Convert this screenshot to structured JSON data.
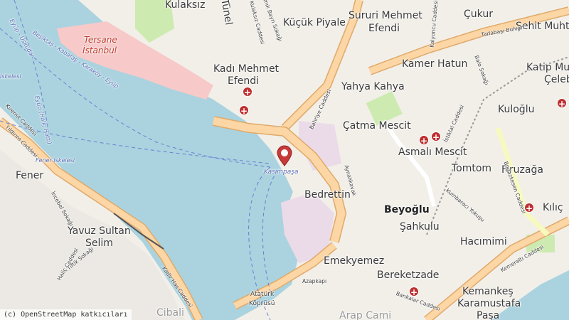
{
  "map": {
    "colors": {
      "water": "#aad3df",
      "land": "#f2efe9",
      "road_major": "#fcd6a4",
      "road_outline": "#e0a96a",
      "industrial": "#ebdbe8",
      "military": "#f7c9c9",
      "park": "#cdebb0"
    },
    "marker": {
      "icon": "map-pin-icon",
      "place": "Kasımpaşa",
      "color": "#c83a3a"
    },
    "districts": {
      "kulaksiz": "Kulaksız",
      "tunel": "Tünel",
      "kucuk_piyale": "Küçük Piyale",
      "sururi": "Sururi Mehmet",
      "efendi1": "Efendi",
      "cukur": "Çukur",
      "sehit": "Şehit Muhtar",
      "tersane": "Tersane",
      "istanbul": "İstanbul",
      "kadi": "Kadı Mehmet",
      "efendi2": "Efendi",
      "kamer": "Kamer Hatun",
      "katip": "Katip Musta",
      "celebi": "Çelebi",
      "yahya": "Yahya Kahya",
      "kuloglu": "Kuloğlu",
      "catma": "Çatma Mescit",
      "asmali": "Asmalı Mescit",
      "tomtom": "Tomtom",
      "firuzaga": "Firuzağa",
      "fener": "Fener",
      "bedrettin": "Bedrettin",
      "beyoglu": "Beyoğlu",
      "kilic": "Kılıç",
      "sahkulu": "Şahkulu",
      "yavuz": "Yavuz Sultan",
      "selim": "Selim",
      "hacimimi": "Hacımimi",
      "emekyemez": "Emekyemez",
      "bereketzade": "Bereketzade",
      "kemankes": "Kemankeş",
      "karamustafa": "Karamustafa",
      "pasa": "Paşa",
      "cibali": "Cibali",
      "arap": "Arap Cami"
    },
    "streets": {
      "kulaksiz_cad": "Kulaksız Caddesi",
      "namik": "Namık Bayrı Sokağı",
      "bahriye": "Bahriye Caddesi",
      "tarlabasi": "Tarlabaşı Bulvarı",
      "balo": "Balo Sokağı",
      "istiklal": "İstiklal Caddesi",
      "bogazkesen": "Boğazkesen Caddesi",
      "kumbaraci": "Kumbaracı Yokuşu",
      "kemeralti": "Kemeraltı Caddesi",
      "bankalar": "Bankalar Caddesi",
      "azapkapi": "Azapkapı",
      "ataturk": "Atatürk",
      "koprusu": "Köprüsü",
      "halic_cad": "Haliç Caddesi",
      "kadir": "Kadir Has Caddesi",
      "sokak_fener": "İncebel Sokağı",
      "tiftik": "Tiftik Sokağı",
      "kiremit": "Kiremit Caddesi",
      "yildirim": "Yıldırım Caddesi",
      "ayni": "Aynalıkavak",
      "kayagan": "Kalyoncu Caddesi",
      "kasimpasa_lbl": "Kasımpaşa"
    },
    "ferry": {
      "route1": "Beşiktaş - Kabataş - Karaköy - Eyüp",
      "route2": "Eyüp - Üsküdar",
      "route3": "Eyüp (Haliç Hattı)",
      "iskele1": "Fener İskelesi",
      "iskele2": "İskelesi"
    },
    "attribution": "(c) OpenStreetMap katkıcıları"
  }
}
